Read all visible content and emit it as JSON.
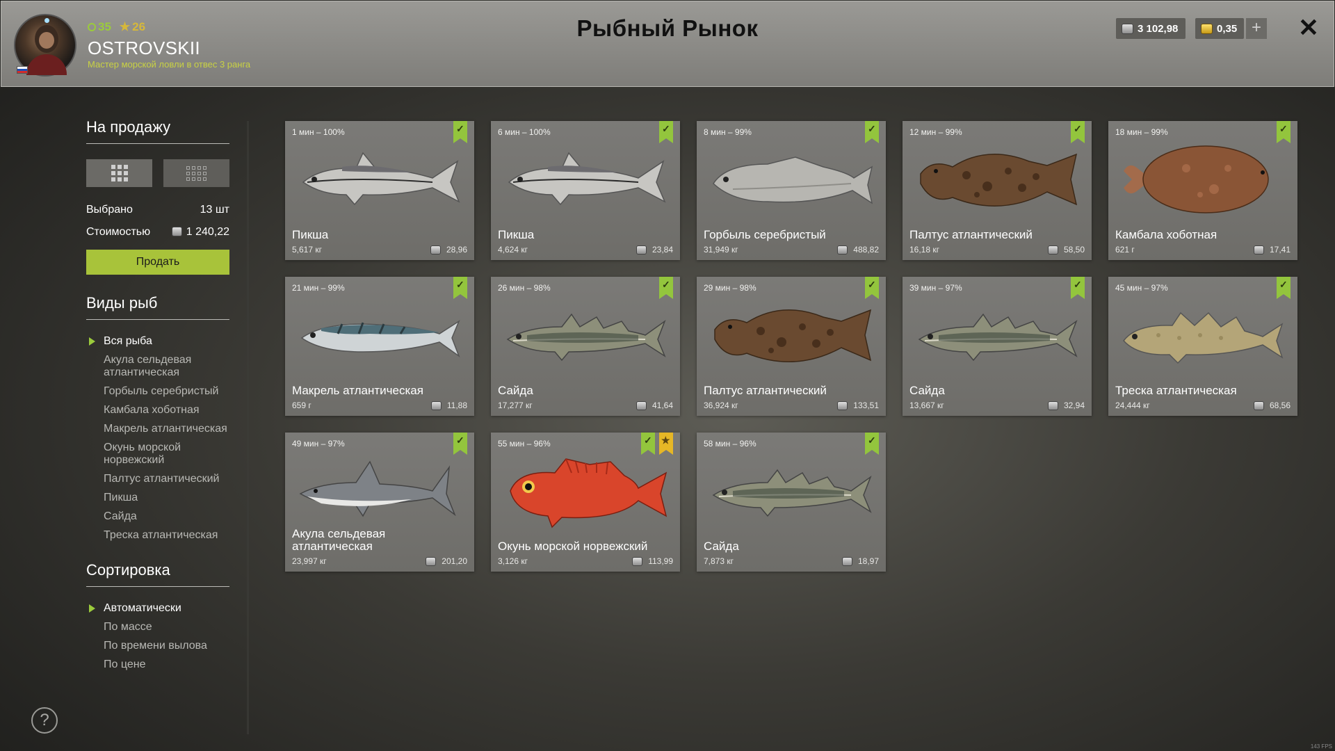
{
  "header": {
    "title": "Рыбный Рынок",
    "level": "35",
    "stars": "26",
    "username": "OSTROVSKII",
    "rank": "Мастер морской ловли в отвес 3 ранга",
    "silver": "3 102,98",
    "gold": "0,35",
    "plus": "+",
    "close": "✕"
  },
  "sidebar": {
    "sale_title": "На продажу",
    "selected_label": "Выбрано",
    "selected_value": "13 шт",
    "cost_label": "Стоимостью",
    "cost_value": "1 240,22",
    "sell_label": "Продать",
    "species_title": "Виды рыб",
    "species": [
      "Вся рыба",
      "Акула сельдевая атлантическая",
      "Горбыль серебристый",
      "Камбала хоботная",
      "Макрель атлантическая",
      "Окунь морской норвежский",
      "Палтус атлантический",
      "Пикша",
      "Сайда",
      "Треска атлантическая"
    ],
    "sort_title": "Сортировка",
    "sort_options": [
      "Автоматически",
      "По массе",
      "По времени вылова",
      "По цене"
    ]
  },
  "help": "?",
  "fps": "143 FPS",
  "cards": [
    {
      "time": "1 мин – 100%",
      "name": "Пикша",
      "weight": "5,617 кг",
      "price": "28,96",
      "fish": "haddock"
    },
    {
      "time": "6 мин – 100%",
      "name": "Пикша",
      "weight": "4,624 кг",
      "price": "23,84",
      "fish": "haddock"
    },
    {
      "time": "8 мин – 99%",
      "name": "Горбыль серебристый",
      "weight": "31,949 кг",
      "price": "488,82",
      "fish": "croaker"
    },
    {
      "time": "12 мин – 99%",
      "name": "Палтус атлантический",
      "weight": "16,18 кг",
      "price": "58,50",
      "fish": "halibut"
    },
    {
      "time": "18 мин – 99%",
      "name": "Камбала хоботная",
      "weight": "621 г",
      "price": "17,41",
      "fish": "flounder"
    },
    {
      "time": "21 мин – 99%",
      "name": "Макрель атлантическая",
      "weight": "659 г",
      "price": "11,88",
      "fish": "mackerel"
    },
    {
      "time": "26 мин – 98%",
      "name": "Сайда",
      "weight": "17,277 кг",
      "price": "41,64",
      "fish": "pollock"
    },
    {
      "time": "29 мин – 98%",
      "name": "Палтус атлантический",
      "weight": "36,924 кг",
      "price": "133,51",
      "fish": "halibut"
    },
    {
      "time": "39 мин – 97%",
      "name": "Сайда",
      "weight": "13,667 кг",
      "price": "32,94",
      "fish": "pollock"
    },
    {
      "time": "45 мин – 97%",
      "name": "Треска атлантическая",
      "weight": "24,444 кг",
      "price": "68,56",
      "fish": "cod"
    },
    {
      "time": "49 мин – 97%",
      "name": "Акула сельдевая атлантическая",
      "weight": "23,997 кг",
      "price": "201,20",
      "fish": "shark"
    },
    {
      "time": "55 мин – 96%",
      "name": "Окунь морской норвежский",
      "weight": "3,126 кг",
      "price": "113,99",
      "fish": "redfish",
      "starred": true
    },
    {
      "time": "58 мин – 96%",
      "name": "Сайда",
      "weight": "7,873 кг",
      "price": "18,97",
      "fish": "pollock"
    }
  ],
  "colors": {
    "accent_green": "#9bcb3c",
    "sell_button": "#a8c33a",
    "star_ribbon": "#e6b726",
    "rank_text": "#c9d243"
  }
}
